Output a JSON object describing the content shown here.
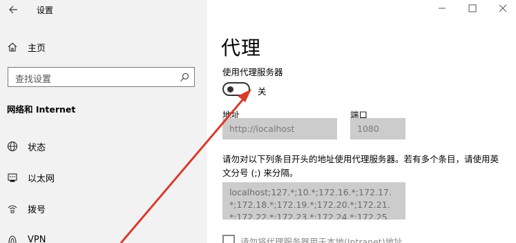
{
  "app": {
    "title": "设置"
  },
  "sidebar": {
    "home": "主页",
    "search": {
      "placeholder": "查找设置"
    },
    "section_title": "网络和 Internet",
    "items": [
      {
        "label": "状态",
        "icon": "globe-icon"
      },
      {
        "label": "以太网",
        "icon": "ethernet-icon"
      },
      {
        "label": "拨号",
        "icon": "dialup-icon"
      },
      {
        "label": "VPN",
        "icon": "vpn-icon"
      }
    ]
  },
  "main": {
    "title": "代理",
    "use_proxy_label": "使用代理服务器",
    "toggle_state": "关",
    "address_label": "地址",
    "address_value": "http://localhost",
    "port_label": "端口",
    "port_value": "1080",
    "exceptions_desc": "请勿对以下列条目开头的地址使用代理服务器。若有多个条目，请使用英文分号 (;) 来分隔。",
    "exceptions_lines": [
      "localhost;127.*;10.*;172.16.*;172.17.",
      "*;172.18.*;172.19.*;172.20.*;172.21.",
      "*;172.22.*;172.23.*;172.24.*;172.25."
    ],
    "local_checkbox_label": "请勿将代理服务器用于本地(Intranet)地址"
  },
  "colors": {
    "sidebar_bg": "#f2f2f2",
    "disabled_field": "#cccccc",
    "annotation_arrow": "#d93a2b"
  }
}
